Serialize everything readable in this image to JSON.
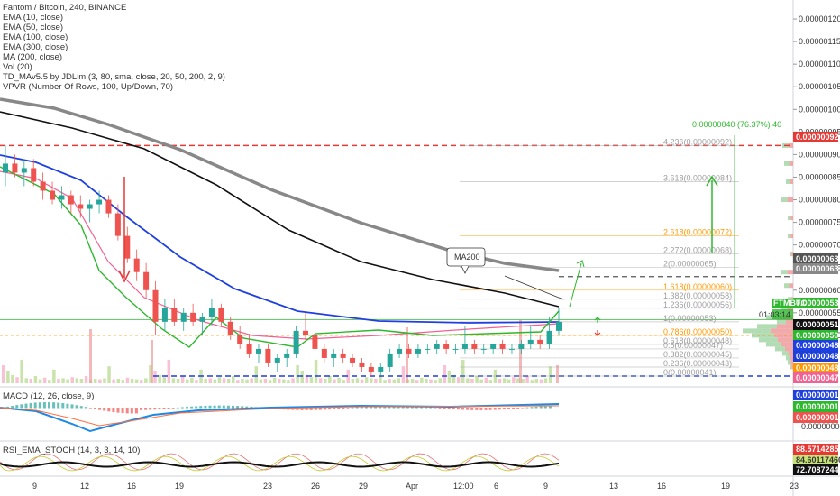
{
  "header": {
    "symbol_line": "Fantom / Bitcoin, 240, BINANCE",
    "indicators": [
      "EMA (10, close)",
      "EMA (50, close)",
      "EMA (100, close)",
      "EMA (300, close)",
      "MA (200, close)",
      "Vol (20)",
      "TD_MAv5.5 by JDLim (3, 80, sma, close, 20, 50, 200, 2, 9)",
      "VPVR (Number Of Rows, 100, Up/Down, 70)"
    ]
  },
  "annotations": {
    "ma200_label": "MA200",
    "measure_label": "0.00000040 (76.37%) 40",
    "symbol_badge": "FTMBTC",
    "countdown": "01:03:14"
  },
  "colors": {
    "bull": "#26a69a",
    "bear": "#ef5350",
    "ema10": "#2db82d",
    "ema50": "#f06292",
    "ema100": "#1e40e0",
    "ema300": "#888888",
    "ma200": "#111111",
    "resistance": "#e53935",
    "support": "#1e3fd6"
  },
  "price_axis": {
    "ticks": [
      "0.00000120",
      "0.00000115",
      "0.00000110",
      "0.00000105",
      "0.00000100",
      "0.00000095",
      "0.00000090",
      "0.00000085",
      "0.00000080",
      "0.00000075",
      "0.00000070",
      "0.00000065",
      "0.00000060",
      "0.00000055",
      "0.00000050"
    ],
    "badges": [
      {
        "text": "0.00000092",
        "color": "#e53935",
        "fg": "#ffffff"
      },
      {
        "text": "0.00000063",
        "color": "#555555",
        "fg": "#ffffff"
      },
      {
        "text": "0.00000063",
        "color": "#888888",
        "fg": "#ffffff"
      },
      {
        "text": "0.00000053",
        "color": "#2db82d",
        "fg": "#ffffff"
      },
      {
        "text": "0.00000051",
        "color": "#111111",
        "fg": "#ffffff"
      },
      {
        "text": "0.00000050",
        "color": "#2db82d",
        "fg": "#ffffff"
      },
      {
        "text": "0.00000048",
        "color": "#1e40e0",
        "fg": "#ffffff"
      },
      {
        "text": "0.00000048",
        "color": "#1e3fd6",
        "fg": "#ffffff"
      },
      {
        "text": "0.00000048",
        "color": "#ff9800",
        "fg": "#ffffff"
      },
      {
        "text": "0.00000047",
        "color": "#f06292",
        "fg": "#ffffff"
      }
    ]
  },
  "fib_levels": [
    {
      "label": "4.236(0.00000092)",
      "price": 9.2e-07,
      "color": "#9e9e9e"
    },
    {
      "label": "3.618(0.00000084)",
      "price": 8.4e-07,
      "color": "#9e9e9e"
    },
    {
      "label": "2.618(0.00000072)",
      "price": 7.2e-07,
      "color": "#ff9800"
    },
    {
      "label": "2.272(0.00000068)",
      "price": 6.8e-07,
      "color": "#9e9e9e"
    },
    {
      "label": "2(0.00000065)",
      "price": 6.5e-07,
      "color": "#9e9e9e"
    },
    {
      "label": "1.618(0.00000060)",
      "price": 6e-07,
      "color": "#ff9800"
    },
    {
      "label": "1.382(0.00000058)",
      "price": 5.8e-07,
      "color": "#9e9e9e"
    },
    {
      "label": "1.236(0.00000056)",
      "price": 5.6e-07,
      "color": "#9e9e9e"
    },
    {
      "label": "1(0.00000053)",
      "price": 5.3e-07,
      "color": "#9e9e9e"
    },
    {
      "label": "0.786(0.00000050)",
      "price": 5e-07,
      "color": "#ff9800"
    },
    {
      "label": "0.618(0.00000048)",
      "price": 4.8e-07,
      "color": "#9e9e9e"
    },
    {
      "label": "0.5(0.00000047)",
      "price": 4.7e-07,
      "color": "#9e9e9e"
    },
    {
      "label": "0.382(0.00000045)",
      "price": 4.5e-07,
      "color": "#9e9e9e"
    },
    {
      "label": "0.236(0.00000043)",
      "price": 4.3e-07,
      "color": "#9e9e9e"
    },
    {
      "label": "0(0.00000041)",
      "price": 4.1e-07,
      "color": "#9e9e9e"
    }
  ],
  "x_axis": {
    "ticks": [
      "9",
      "12",
      "16",
      "19",
      "23",
      "26",
      "29",
      "Apr",
      "12:00",
      "6",
      "9",
      "13",
      "16",
      "19",
      "23"
    ]
  },
  "macd": {
    "title": "MACD (12, 26, close, 9)",
    "ticks": [
      "-0.00000005"
    ],
    "badges": [
      {
        "text": "0.00000001",
        "color": "#1e40e0"
      },
      {
        "text": "0.00000001",
        "color": "#2db82d"
      },
      {
        "text": "0.00000001",
        "color": "#ef5350"
      }
    ]
  },
  "rsi": {
    "title": "RSI_EMA_STOCH (14, 3, 3, 14, 10)",
    "badges": [
      {
        "text": "88.57142857",
        "color": "#e53935",
        "fg": "#ffffff"
      },
      {
        "text": "84.60117460",
        "color": "#c6e377",
        "fg": "#333333"
      },
      {
        "text": "72.70872444",
        "color": "#111111",
        "fg": "#ffffff"
      }
    ]
  },
  "chart_data": {
    "type": "candlestick",
    "title": "Fantom / Bitcoin, 240, BINANCE",
    "price_range": [
      4e-07,
      1.23e-06
    ],
    "key_levels": {
      "resistance": 9.2e-07,
      "support": 4.1e-07,
      "target": 6.3e-07,
      "current": 5.1e-07
    },
    "projection": {
      "from": 5.2e-07,
      "to": 9.2e-07,
      "change": "0.00000040 (76.37%) 40"
    },
    "series": [
      {
        "name": "EMA (10, close)",
        "color": "#2db82d"
      },
      {
        "name": "EMA (50, close)",
        "color": "#f06292"
      },
      {
        "name": "EMA (100, close)",
        "color": "#1e40e0"
      },
      {
        "name": "EMA (300, close)",
        "color": "#888888"
      },
      {
        "name": "MA (200, close)",
        "color": "#111111"
      }
    ],
    "ohlc": [
      [
        8.6e-07,
        9.2e-07,
        8.3e-07,
        8.8e-07
      ],
      [
        8.8e-07,
        9e-07,
        8.5e-07,
        8.6e-07
      ],
      [
        8.6e-07,
        8.9e-07,
        8.3e-07,
        8.7e-07
      ],
      [
        8.7e-07,
        8.9e-07,
        8.3e-07,
        8.4e-07
      ],
      [
        8.4e-07,
        8.6e-07,
        8e-07,
        8.2e-07
      ],
      [
        8.2e-07,
        8.4e-07,
        7.9e-07,
        8e-07
      ],
      [
        8e-07,
        8.3e-07,
        7.8e-07,
        8.1e-07
      ],
      [
        8.1e-07,
        8.2e-07,
        7.7e-07,
        7.9e-07
      ],
      [
        7.9e-07,
        8.1e-07,
        7.6e-07,
        7.8e-07
      ],
      [
        7.8e-07,
        8e-07,
        7.5e-07,
        7.9e-07
      ],
      [
        7.9e-07,
        8.2e-07,
        7.7e-07,
        8e-07
      ],
      [
        8e-07,
        8.1e-07,
        7.6e-07,
        7.7e-07
      ],
      [
        7.7e-07,
        7.9e-07,
        7.1e-07,
        7.2e-07
      ],
      [
        7.2e-07,
        7.4e-07,
        6.6e-07,
        6.7e-07
      ],
      [
        6.7e-07,
        6.9e-07,
        6.2e-07,
        6.4e-07
      ],
      [
        6.4e-07,
        6.6e-07,
        5.8e-07,
        6e-07
      ],
      [
        6e-07,
        6.2e-07,
        5e-07,
        5.3e-07
      ],
      [
        5.3e-07,
        5.8e-07,
        5.1e-07,
        5.6e-07
      ],
      [
        5.6e-07,
        5.8e-07,
        5.2e-07,
        5.3e-07
      ],
      [
        5.3e-07,
        5.6e-07,
        5.1e-07,
        5.5e-07
      ],
      [
        5.5e-07,
        5.7e-07,
        5.2e-07,
        5.3e-07
      ],
      [
        5.3e-07,
        5.5e-07,
        5e-07,
        5.4e-07
      ],
      [
        5.4e-07,
        5.8e-07,
        5.2e-07,
        5.6e-07
      ],
      [
        5.6e-07,
        5.7e-07,
        5.2e-07,
        5.3e-07
      ],
      [
        5.3e-07,
        5.4e-07,
        4.9e-07,
        5e-07
      ],
      [
        5e-07,
        5.2e-07,
        4.7e-07,
        4.8e-07
      ],
      [
        4.8e-07,
        5e-07,
        4.5e-07,
        4.6e-07
      ],
      [
        4.6e-07,
        4.8e-07,
        4.4e-07,
        4.7e-07
      ],
      [
        4.7e-07,
        4.8e-07,
        4.3e-07,
        4.4e-07
      ],
      [
        4.4e-07,
        4.6e-07,
        4.2e-07,
        4.5e-07
      ],
      [
        4.5e-07,
        4.7e-07,
        4.3e-07,
        4.6e-07
      ],
      [
        4.6e-07,
        5.2e-07,
        4.5e-07,
        5.1e-07
      ],
      [
        5.1e-07,
        5.5e-07,
        4.9e-07,
        5e-07
      ],
      [
        5e-07,
        5.1e-07,
        4.6e-07,
        4.7e-07
      ],
      [
        4.7e-07,
        4.8e-07,
        4.4e-07,
        4.5e-07
      ],
      [
        4.5e-07,
        4.7e-07,
        4.3e-07,
        4.6e-07
      ],
      [
        4.6e-07,
        4.7e-07,
        4.4e-07,
        4.5e-07
      ],
      [
        4.5e-07,
        4.6e-07,
        4.3e-07,
        4.4e-07
      ],
      [
        4.4e-07,
        4.5e-07,
        4.2e-07,
        4.3e-07
      ],
      [
        4.3e-07,
        4.4e-07,
        4.1e-07,
        4.2e-07
      ],
      [
        4.2e-07,
        4.4e-07,
        4.1e-07,
        4.3e-07
      ],
      [
        4.3e-07,
        4.7e-07,
        4.2e-07,
        4.6e-07
      ],
      [
        4.6e-07,
        4.8e-07,
        4.5e-07,
        4.7e-07
      ],
      [
        4.7e-07,
        4.8e-07,
        4.5e-07,
        4.6e-07
      ],
      [
        4.6e-07,
        4.8e-07,
        4.5e-07,
        4.7e-07
      ],
      [
        4.7e-07,
        4.8e-07,
        4.6e-07,
        4.7e-07
      ],
      [
        4.7e-07,
        4.9e-07,
        4.6e-07,
        4.8e-07
      ],
      [
        4.8e-07,
        4.9e-07,
        4.6e-07,
        4.7e-07
      ],
      [
        4.7e-07,
        4.8e-07,
        4.6e-07,
        4.7e-07
      ],
      [
        4.7e-07,
        5.2e-07,
        4.6e-07,
        4.8e-07
      ],
      [
        4.8e-07,
        4.9e-07,
        4.6e-07,
        4.7e-07
      ],
      [
        4.7e-07,
        4.8e-07,
        4.6e-07,
        4.7e-07
      ],
      [
        4.7e-07,
        4.8e-07,
        4.6e-07,
        4.8e-07
      ],
      [
        4.8e-07,
        4.9e-07,
        4.6e-07,
        4.7e-07
      ],
      [
        4.7e-07,
        4.8e-07,
        4.6e-07,
        4.7e-07
      ],
      [
        4.7e-07,
        4.9e-07,
        4.6e-07,
        4.8e-07
      ],
      [
        4.8e-07,
        5.2e-07,
        4.7e-07,
        4.9e-07
      ],
      [
        4.9e-07,
        5e-07,
        4.7e-07,
        4.8e-07
      ],
      [
        4.8e-07,
        5.4e-07,
        4.7e-07,
        5.1e-07
      ],
      [
        5.1e-07,
        5.6e-07,
        5e-07,
        5.3e-07
      ]
    ]
  }
}
